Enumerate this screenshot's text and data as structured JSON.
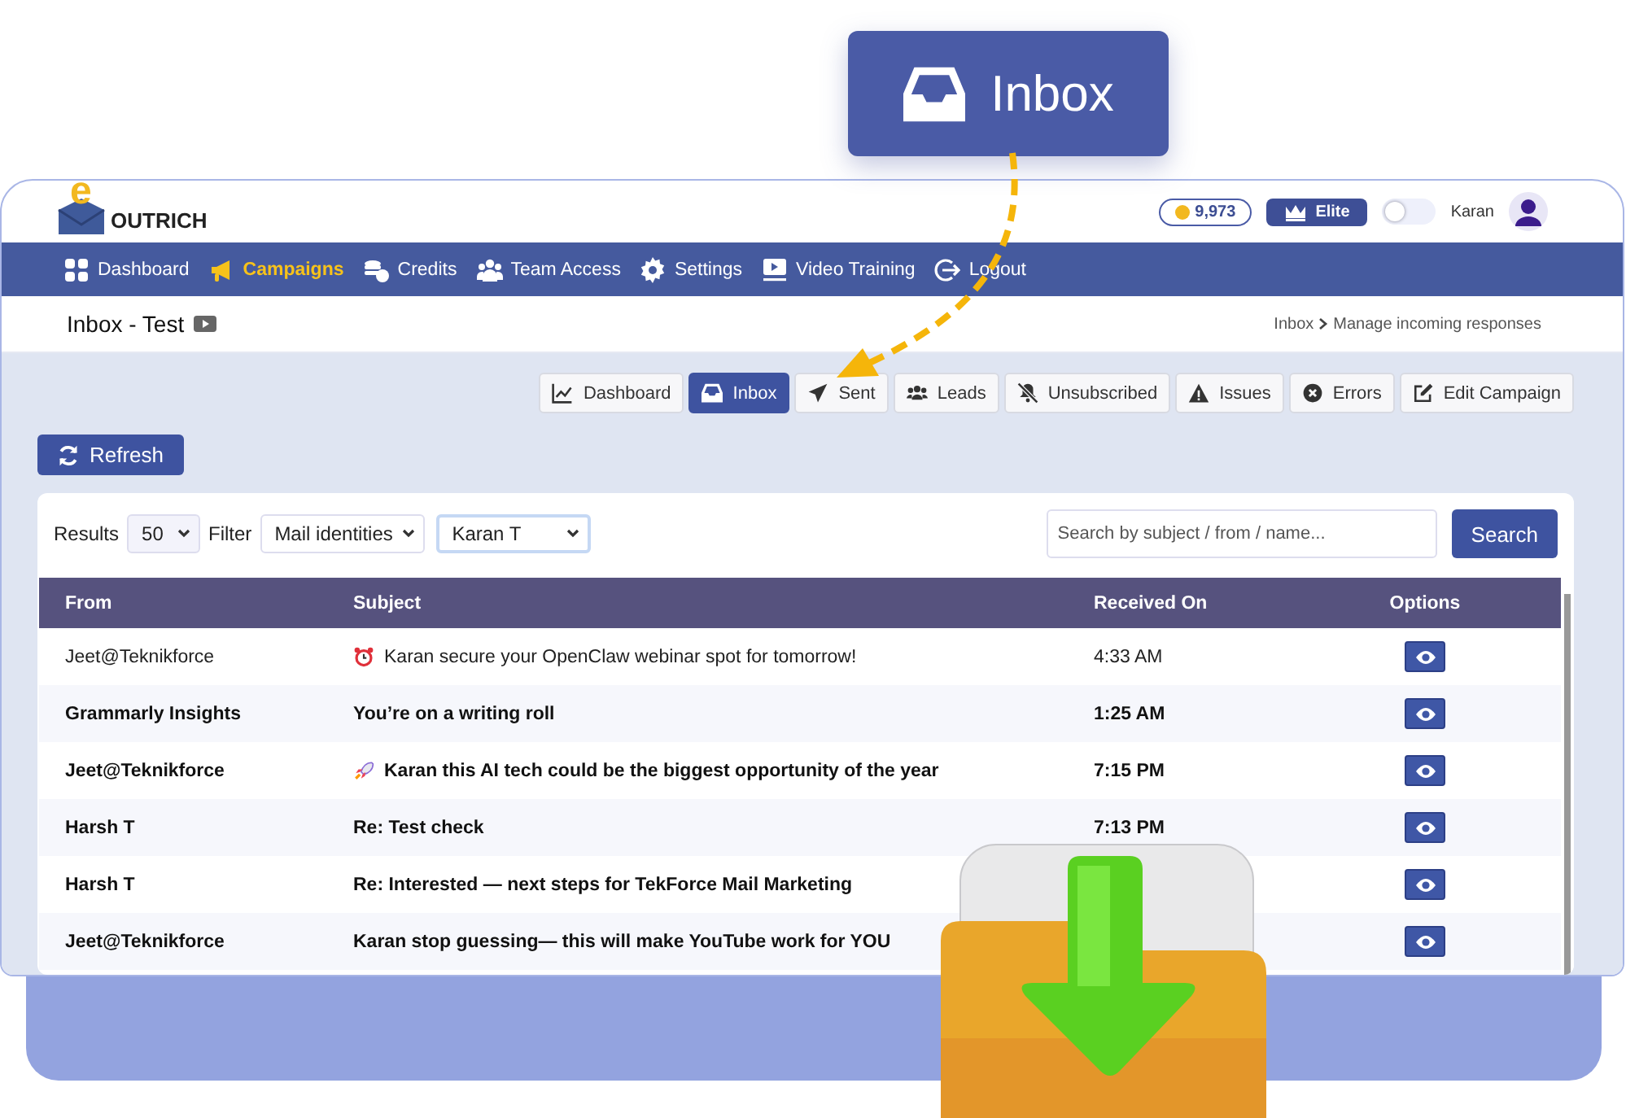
{
  "callout": {
    "label": "Inbox"
  },
  "header": {
    "logo_mark": "e",
    "logo_text": "OUTRICH",
    "credits": "9,973",
    "plan": "Elite",
    "theme_toggle": {
      "on": false
    },
    "user": "Karan"
  },
  "nav": [
    {
      "label": "Dashboard",
      "selected": false
    },
    {
      "label": "Campaigns",
      "selected": true
    },
    {
      "label": "Credits",
      "selected": false
    },
    {
      "label": "Team Access",
      "selected": false
    },
    {
      "label": "Settings",
      "selected": false
    },
    {
      "label": "Video Training",
      "selected": false
    },
    {
      "label": "Logout",
      "selected": false
    }
  ],
  "page": {
    "title": "Inbox - Test",
    "breadcrumb": [
      "Inbox",
      "Manage incoming responses"
    ]
  },
  "tabs": [
    {
      "label": "Dashboard",
      "selected": false
    },
    {
      "label": "Inbox",
      "selected": true
    },
    {
      "label": "Sent",
      "selected": false
    },
    {
      "label": "Leads",
      "selected": false
    },
    {
      "label": "Unsubscribed",
      "selected": false
    },
    {
      "label": "Issues",
      "selected": false
    },
    {
      "label": "Errors",
      "selected": false
    },
    {
      "label": "Edit Campaign",
      "selected": false
    }
  ],
  "refresh": "Refresh",
  "filters": {
    "results_label": "Results",
    "results": "50",
    "filter_label": "Filter",
    "filter": "Mail identities",
    "identity": "Karan T",
    "search_placeholder": "Search by subject / from / name...",
    "search_button": "Search"
  },
  "table": {
    "columns": [
      "From",
      "Subject",
      "Received On",
      "Options"
    ],
    "rows": [
      {
        "from": "Jeet@Teknikforce",
        "kind": "alarm",
        "subject": "Karan secure your OpenClaw webinar spot for tomorrow!",
        "received": "4:33 AM",
        "unread": false
      },
      {
        "from": "Grammarly Insights",
        "subject": "You’re on a writing roll",
        "received": "1:25 AM",
        "unread": true
      },
      {
        "from": "Jeet@Teknikforce",
        "kind": "rocket",
        "subject": "Karan this AI tech could be the biggest opportunity of the year",
        "received": "7:15 PM",
        "unread": true
      },
      {
        "from": "Harsh T",
        "subject": "Re: Test check",
        "received": "7:13 PM",
        "unread": true
      },
      {
        "from": "Harsh T",
        "subject": "Re: Interested — next steps for TekForce Mail Marketing",
        "unread": true
      },
      {
        "from": "Jeet@Teknikforce",
        "subject": "Karan stop guessing— this will make YouTube work for YOU",
        "unread": true
      }
    ]
  }
}
